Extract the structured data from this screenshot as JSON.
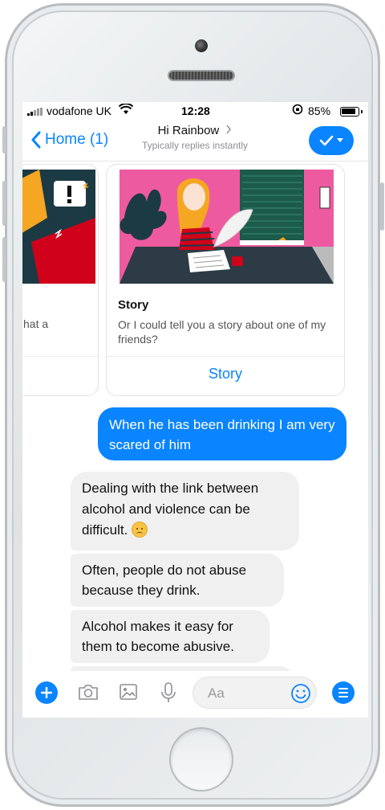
{
  "status_bar": {
    "carrier": "vodafone UK",
    "time": "12:28",
    "battery": "85%"
  },
  "nav": {
    "back_label": "Home (1)",
    "title": "Hi Rainbow",
    "subtitle": "Typically replies instantly"
  },
  "cards": {
    "left_partial_text": "hat a",
    "story": {
      "title": "Story",
      "subtitle": "Or I could tell you a story about one of my friends?",
      "button": "Story"
    }
  },
  "messages": {
    "outgoing": "When he has been drinking I am very scared of him",
    "incoming": [
      "Dealing with the link between alcohol and violence can be difficult.",
      "Often, people do not abuse because they drink.",
      "Alcohol makes it easy for them to become abusive."
    ]
  },
  "composer": {
    "placeholder": "Aa"
  },
  "colors": {
    "accent": "#0a84ff",
    "bubble_in": "#f0f0f0",
    "illustration_pink": "#ee5aa0",
    "illustration_dark": "#1c3a44"
  },
  "icons": [
    "signal-icon",
    "wifi-icon",
    "lock-rotation-icon",
    "battery-icon",
    "chevron-left-icon",
    "chevron-right-icon",
    "checkmark-icon",
    "plus-icon",
    "camera-icon",
    "image-icon",
    "microphone-icon",
    "smile-icon",
    "menu-icon"
  ]
}
